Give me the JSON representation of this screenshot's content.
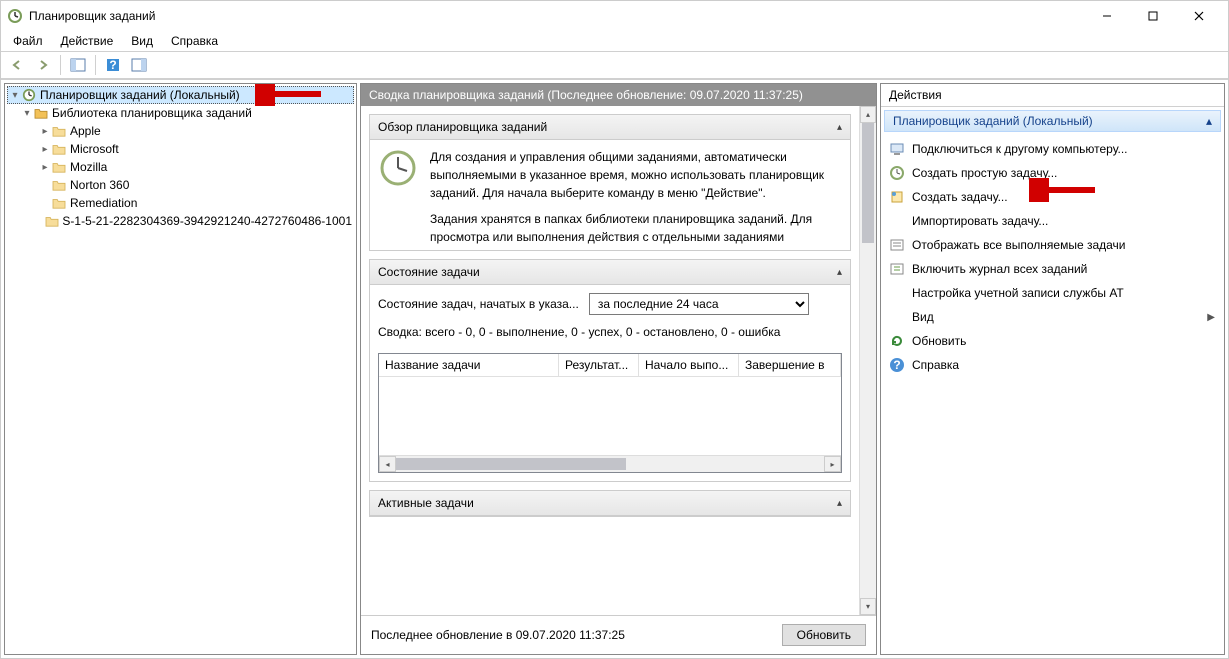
{
  "title": "Планировщик заданий",
  "menu": {
    "file": "Файл",
    "action": "Действие",
    "view": "Вид",
    "help": "Справка"
  },
  "tree": {
    "root": "Планировщик заданий (Локальный)",
    "library": "Библиотека планировщика заданий",
    "items": [
      "Apple",
      "Microsoft",
      "Mozilla",
      "Norton 360",
      "Remediation",
      "S-1-5-21-2282304369-3942921240-4272760486-1001"
    ]
  },
  "center": {
    "header": "Сводка планировщика заданий (Последнее обновление: 09.07.2020 11:37:25)",
    "overview_title": "Обзор планировщика заданий",
    "overview_p1": "Для создания и управления общими заданиями, автоматически выполняемыми в указанное время, можно использовать планировщик заданий. Для начала выберите команду в меню \"Действие\".",
    "overview_p2": "Задания хранятся в папках библиотеки планировщика заданий. Для просмотра или выполнения действия с отдельными заданиями",
    "status_title": "Состояние задачи",
    "status_label": "Состояние задач, начатых в указа...",
    "status_option": "за последние 24 часа",
    "summary": "Сводка: всего - 0, 0 - выполнение, 0 - успех, 0 - остановлено, 0 - ошибка",
    "cols": {
      "name": "Название задачи",
      "result": "Результат...",
      "start": "Начало выпо...",
      "end": "Завершение в"
    },
    "active_title": "Активные задачи",
    "last_update": "Последнее обновление в 09.07.2020 11:37:25",
    "refresh_btn": "Обновить"
  },
  "actions": {
    "title": "Действия",
    "group": "Планировщик заданий (Локальный)",
    "items": [
      "Подключиться к другому компьютеру...",
      "Создать простую задачу...",
      "Создать задачу...",
      "Импортировать задачу...",
      "Отображать все выполняемые задачи",
      "Включить журнал всех заданий",
      "Настройка учетной записи службы AT",
      "Вид",
      "Обновить",
      "Справка"
    ]
  }
}
